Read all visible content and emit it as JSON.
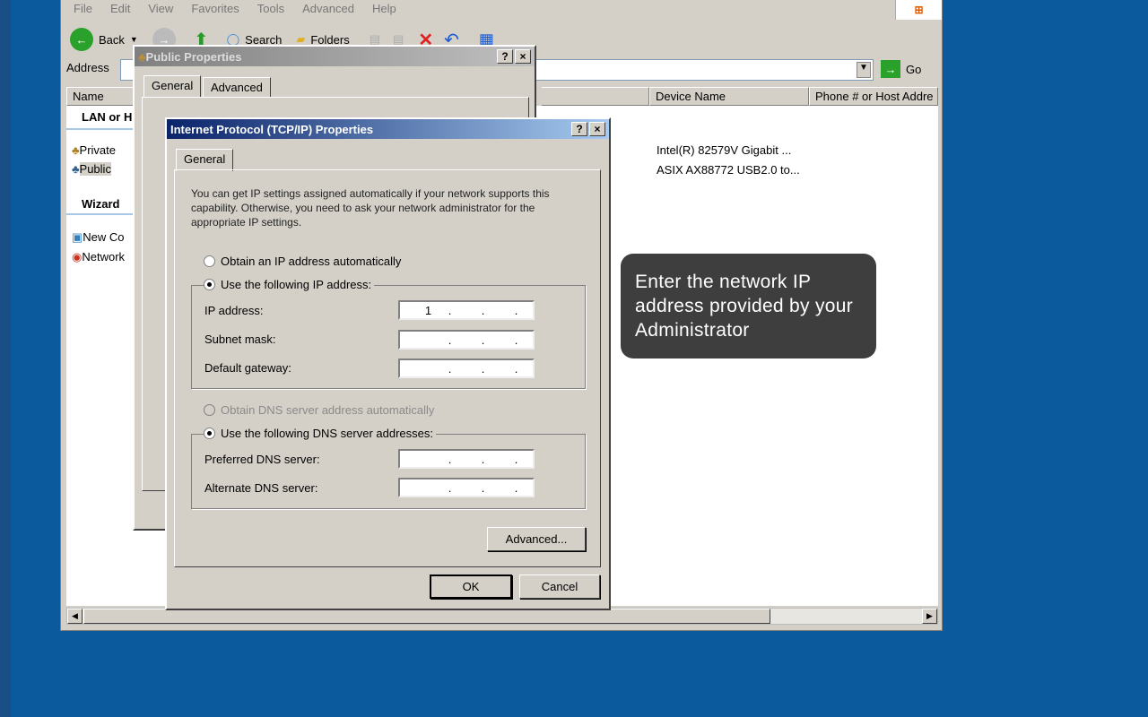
{
  "explorer": {
    "menu": [
      "File",
      "Edit",
      "View",
      "Favorites",
      "Tools",
      "Advanced",
      "Help"
    ],
    "toolbar": {
      "back": "Back",
      "search": "Search",
      "folders": "Folders"
    },
    "address_label": "Address",
    "go_label": "Go",
    "columns": [
      "Name",
      "Device Name",
      "Phone # or Host Addre"
    ],
    "left_group_lan": "LAN or H",
    "left_group_wizard": "Wizard",
    "connections": [
      {
        "name": "Private",
        "device": "Intel(R) 82579V Gigabit ..."
      },
      {
        "name": "Public",
        "device": "ASIX AX88772 USB2.0 to..."
      }
    ],
    "wizard_items": [
      "New Co",
      "Network"
    ]
  },
  "public_dialog": {
    "title": "Public Properties",
    "tabs": [
      "General",
      "Advanced"
    ],
    "help": "?",
    "close": "×"
  },
  "tcpip_dialog": {
    "title": "Internet Protocol (TCP/IP) Properties",
    "help": "?",
    "close": "×",
    "tab": "General",
    "description": "You can get IP settings assigned automatically if your network supports this capability. Otherwise, you need to ask your network administrator for the appropriate IP settings.",
    "radio_auto_ip": "Obtain an IP address automatically",
    "radio_manual_ip": "Use the following IP address:",
    "ip_label": "IP address:",
    "ip_value": "1",
    "subnet_label": "Subnet mask:",
    "gateway_label": "Default gateway:",
    "radio_auto_dns": "Obtain DNS server address automatically",
    "radio_manual_dns": "Use the following DNS server addresses:",
    "pref_dns_label": "Preferred DNS server:",
    "alt_dns_label": "Alternate DNS server:",
    "advanced_btn": "Advanced...",
    "ok_btn": "OK",
    "cancel_btn": "Cancel"
  },
  "callout": "Enter the network IP address provided by your Administrator"
}
